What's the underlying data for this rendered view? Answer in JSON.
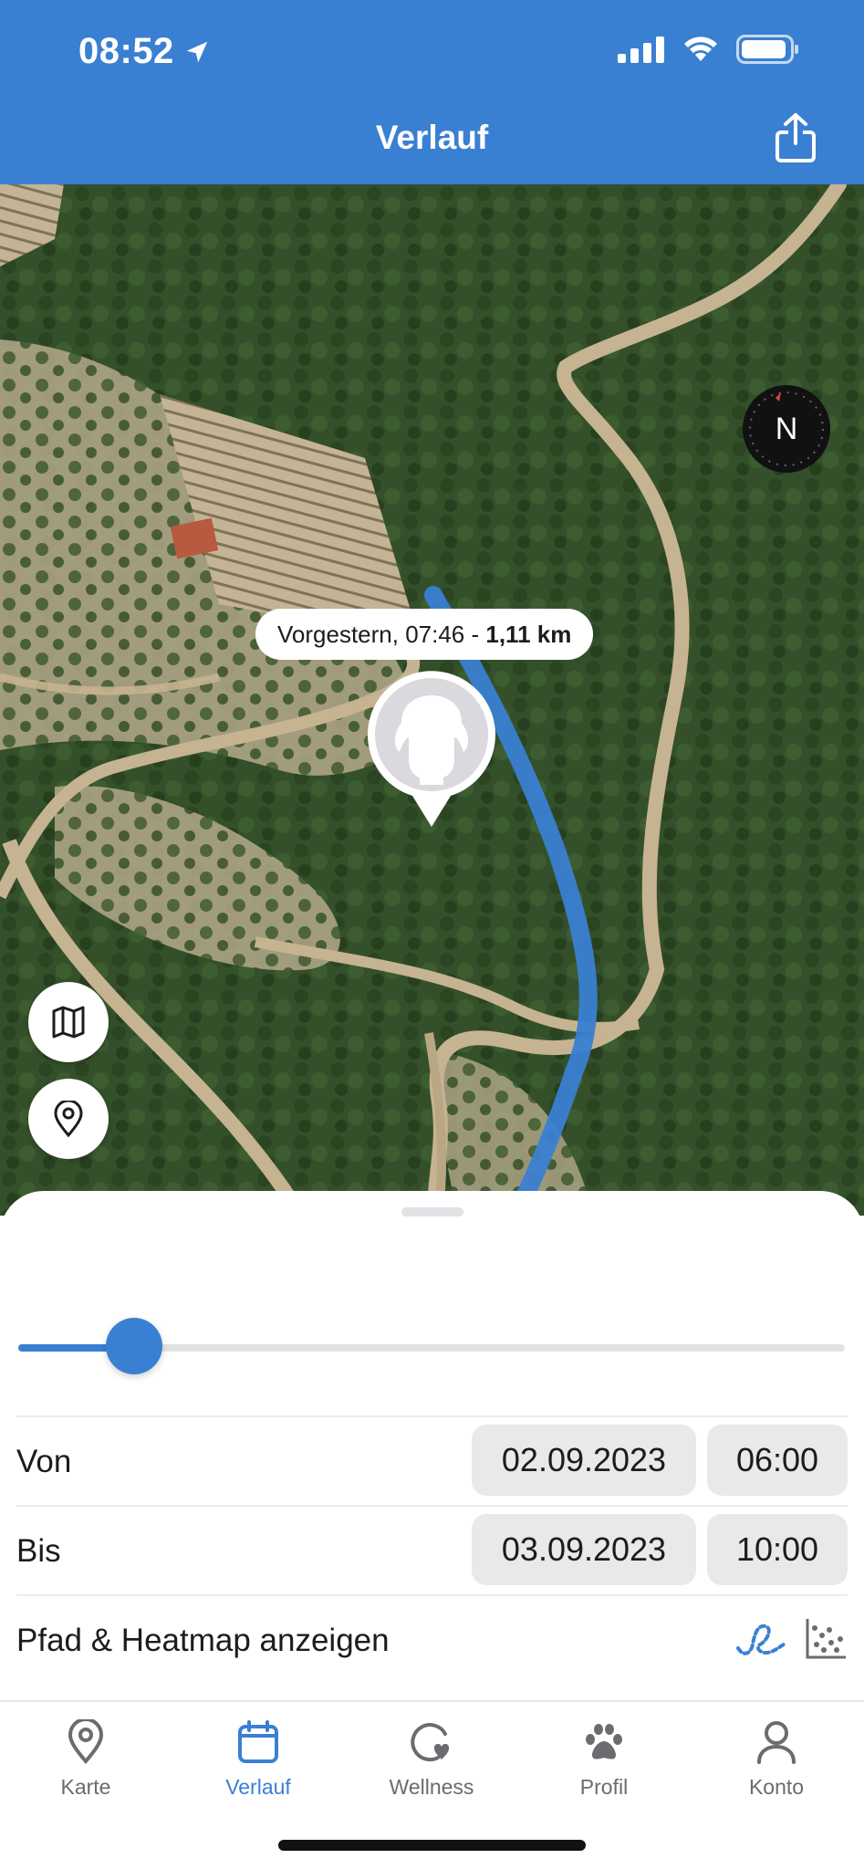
{
  "status_bar": {
    "time": "08:52"
  },
  "header": {
    "title": "Verlauf",
    "share_icon": "share-icon"
  },
  "map": {
    "compass_label": "N",
    "tooltip": {
      "date_time": "Vorgestern, 07:46 - ",
      "distance": "1,11 km"
    },
    "route_color": "#3a80d2",
    "buttons": [
      "map-icon",
      "location-pin-icon"
    ]
  },
  "timeline": {
    "slider_position_fraction": 0.14
  },
  "filter": {
    "from": {
      "label": "Von",
      "date": "02.09.2023",
      "time": "06:00"
    },
    "to": {
      "label": "Bis",
      "date": "03.09.2023",
      "time": "10:00"
    },
    "path_heatmap_label": "Pfad & Heatmap anzeigen"
  },
  "tabbar": {
    "items": [
      {
        "label": "Karte",
        "icon": "map-pin-icon",
        "active": false
      },
      {
        "label": "Verlauf",
        "icon": "calendar-icon",
        "active": true
      },
      {
        "label": "Wellness",
        "icon": "wellness-icon",
        "active": false
      },
      {
        "label": "Profil",
        "icon": "paw-icon",
        "active": false
      },
      {
        "label": "Konto",
        "icon": "account-icon",
        "active": false
      }
    ]
  },
  "colors": {
    "accent": "#3a80d2",
    "text": "#1c1c1e",
    "pill_bg": "#e9e9ec"
  }
}
